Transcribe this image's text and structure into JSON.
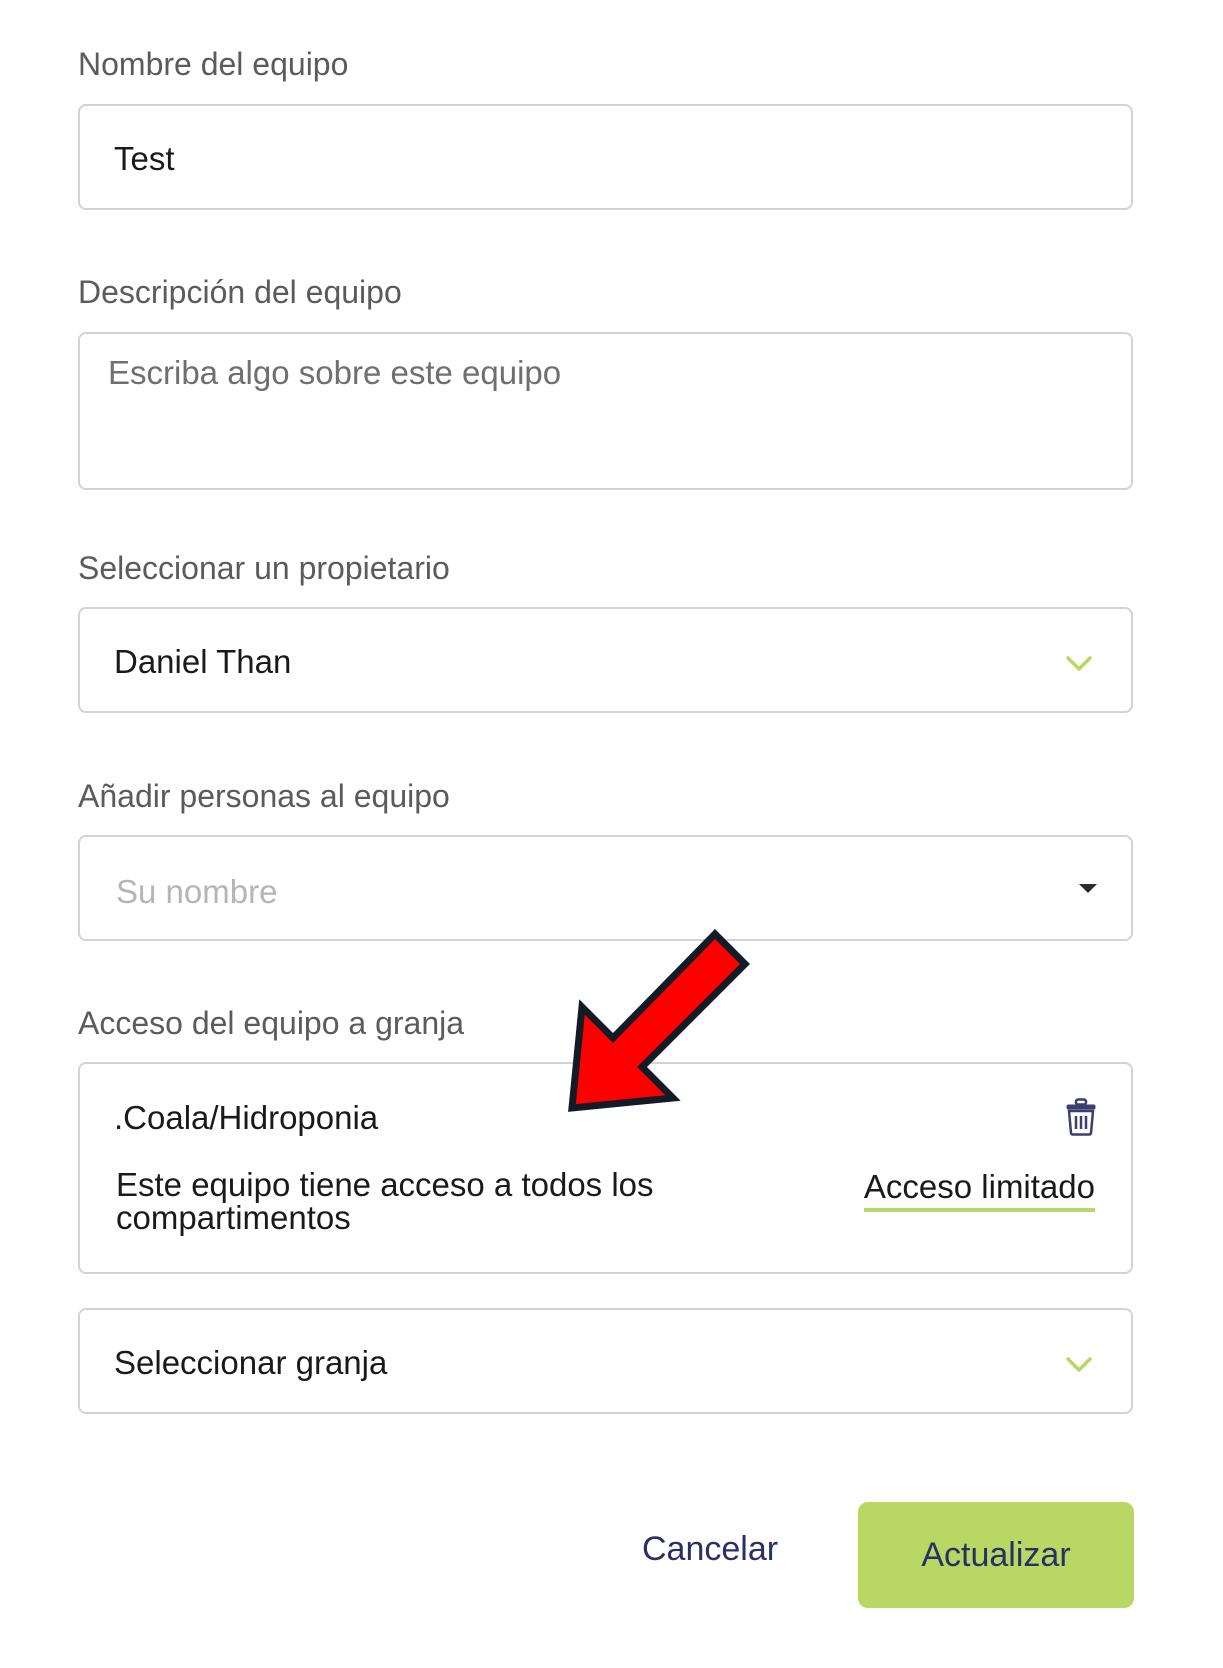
{
  "team_name": {
    "label": "Nombre del equipo",
    "value": "Test"
  },
  "team_description": {
    "label": "Descripción del equipo",
    "placeholder": "Escriba algo sobre este equipo"
  },
  "owner": {
    "label": "Seleccionar un propietario",
    "selected": "Daniel Than"
  },
  "members": {
    "label": "Añadir personas al equipo",
    "placeholder": "Su nombre"
  },
  "farm_access": {
    "label": "Acceso del equipo a granja",
    "farm_name": ".Coala/Hidroponia",
    "access_line1": "Este equipo tiene acceso a todos los",
    "access_line2": "compartimentos",
    "limited_link": "Acceso limitado"
  },
  "farm_select": {
    "placeholder": "Seleccionar granja"
  },
  "actions": {
    "cancel": "Cancelar",
    "update": "Actualizar"
  },
  "colors": {
    "accent_green": "#b8d863",
    "button_text": "#2a2f66",
    "annotation_arrow": "#ff0000"
  }
}
